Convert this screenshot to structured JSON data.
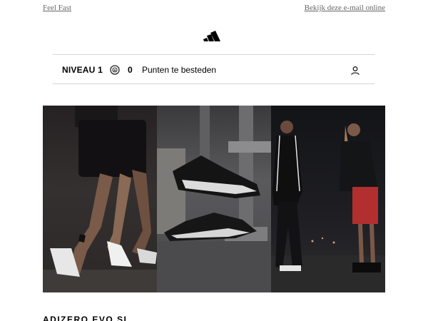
{
  "preheader": {
    "left_link": "Feel Fast",
    "right_link": "Bekijk deze e-mail online"
  },
  "brand": {
    "logo_icon": "adidas-logo-icon"
  },
  "loyalty": {
    "level_label": "NIVEAU 1",
    "points": "0",
    "points_label": "Punten te besteden",
    "coin_icon": "coin-icon",
    "account_icon": "user-icon"
  },
  "hero": {
    "panels": [
      "runners-legs-shoes",
      "shoes-on-pipes",
      "two-models-standing"
    ]
  },
  "product": {
    "title": "ADIZERO EVO SL"
  },
  "colors": {
    "text": "#000000",
    "muted": "#666666",
    "divider": "#d4d4d4"
  }
}
